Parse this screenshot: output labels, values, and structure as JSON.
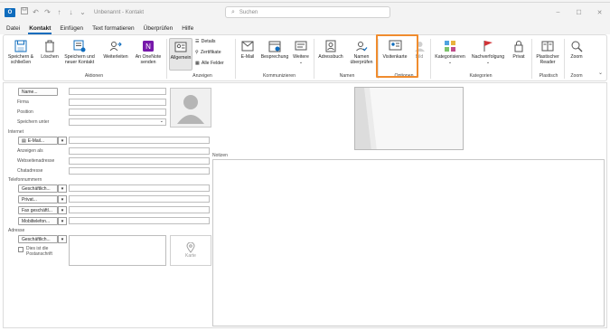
{
  "window": {
    "app_letter": "O",
    "title": "Unbenannt - Kontakt",
    "search_placeholder": "Suchen",
    "min": "–",
    "max": "☐",
    "close": "✕"
  },
  "menu": {
    "tabs": [
      {
        "label": "Datei"
      },
      {
        "label": "Kontakt"
      },
      {
        "label": "Einfügen"
      },
      {
        "label": "Text formatieren"
      },
      {
        "label": "Überprüfen"
      },
      {
        "label": "Hilfe"
      }
    ]
  },
  "ribbon": {
    "save_close": "Speichern & schließen",
    "delete": "Löschen",
    "save_new": "Speichern und neuer Kontakt",
    "forward": "Weiterleiten",
    "onenote": "An OneNote senden",
    "group_actions": "Aktionen",
    "general": "Allgemein",
    "details": "Details",
    "certificates": "Zertifikate",
    "all_fields": "Alle Felder",
    "group_views": "Anzeigen",
    "email": "E-Mail",
    "meeting": "Besprechung",
    "more": "Weitere",
    "group_communicate": "Kommunizieren",
    "address_book": "Adressbuch",
    "check_names": "Namen überprüfen",
    "group_names": "Namen",
    "business_card": "Visitenkarte",
    "picture": "Bild",
    "group_options": "Optionen",
    "categorize": "Kategorisieren",
    "follow_up": "Nachverfolgung",
    "private": "Privat",
    "group_tags": "Kategorien",
    "immersive_reader": "Plastischer Reader",
    "group_immersive": "Plastisch",
    "zoom": "Zoom",
    "group_zoom": "Zoom"
  },
  "form": {
    "name_button": "Name...",
    "company": "Firma",
    "position": "Position",
    "file_as": "Speichern unter",
    "internet": "Internet",
    "email_button": "E-Mail...",
    "display_as": "Anzeigen als",
    "web_address": "Webseitenadresse",
    "im_address": "Chatadresse",
    "phone_numbers": "Telefonnummern",
    "phone_business": "Geschäftlich...",
    "phone_home": "Privat...",
    "phone_fax": "Fax geschäftl...",
    "phone_mobile": "Mobiltelefon...",
    "addresses": "Adresse",
    "address_business": "Geschäftlich...",
    "mailing_address": "Dies ist die Postanschrift",
    "map_it": "Karte",
    "notes": "Notizen"
  }
}
